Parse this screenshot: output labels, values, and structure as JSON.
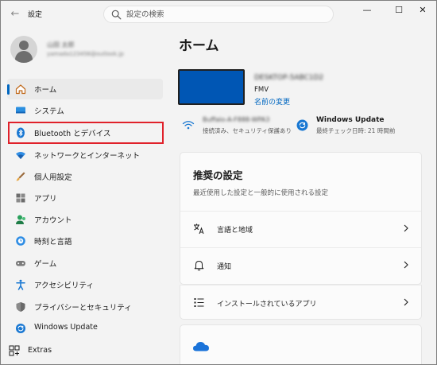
{
  "window": {
    "title": "設定",
    "back_glyph": "←",
    "controls": {
      "minimize": "—",
      "maximize": "☐",
      "close": "✕"
    }
  },
  "search": {
    "placeholder": "設定の検索",
    "value": ""
  },
  "profile": {
    "name": "山田 太郎",
    "email": "yamada123456@outlook.jp"
  },
  "sidebar": {
    "items": [
      {
        "label": "ホーム",
        "icon": "home-icon",
        "active": true
      },
      {
        "label": "システム",
        "icon": "system-icon"
      },
      {
        "label": "Bluetooth とデバイス",
        "icon": "bluetooth-icon",
        "highlighted": true
      },
      {
        "label": "ネットワークとインターネット",
        "icon": "network-icon"
      },
      {
        "label": "個人用設定",
        "icon": "personalization-icon"
      },
      {
        "label": "アプリ",
        "icon": "apps-icon"
      },
      {
        "label": "アカウント",
        "icon": "accounts-icon"
      },
      {
        "label": "時刻と言語",
        "icon": "time-language-icon"
      },
      {
        "label": "ゲーム",
        "icon": "gaming-icon"
      },
      {
        "label": "アクセシビリティ",
        "icon": "accessibility-icon"
      },
      {
        "label": "プライバシーとセキュリティ",
        "icon": "privacy-shield-icon"
      },
      {
        "label": "Windows Update",
        "icon": "windows-update-icon"
      }
    ],
    "extras": {
      "label": "Extras",
      "icon": "extras-icon"
    }
  },
  "main": {
    "title": "ホーム",
    "device": {
      "name": "DESKTOP-5ABC1D2",
      "model": "FMV",
      "rename_link": "名前の変更"
    },
    "network": {
      "name": "Buffalo-A-F888-WPA3",
      "status": "接続済み、セキュリティ保護あり"
    },
    "update": {
      "title": "Windows Update",
      "status": "最終チェック日時: 21 時間前"
    },
    "recommended": {
      "title": "推奨の設定",
      "subtitle": "最近使用した設定と一般的に使用される設定",
      "rows": [
        {
          "label": "言語と地域",
          "icon": "language-region-icon"
        },
        {
          "label": "通知",
          "icon": "notification-bell-icon"
        },
        {
          "label": "インストールされているアプリ",
          "icon": "installed-apps-icon"
        }
      ]
    },
    "cloud_card": {
      "icon": "onedrive-cloud-icon"
    }
  },
  "colors": {
    "accent": "#0067c0",
    "highlight_border": "#e0212a",
    "device_thumb": "#0056b4",
    "onedrive": "#1a73d9"
  }
}
